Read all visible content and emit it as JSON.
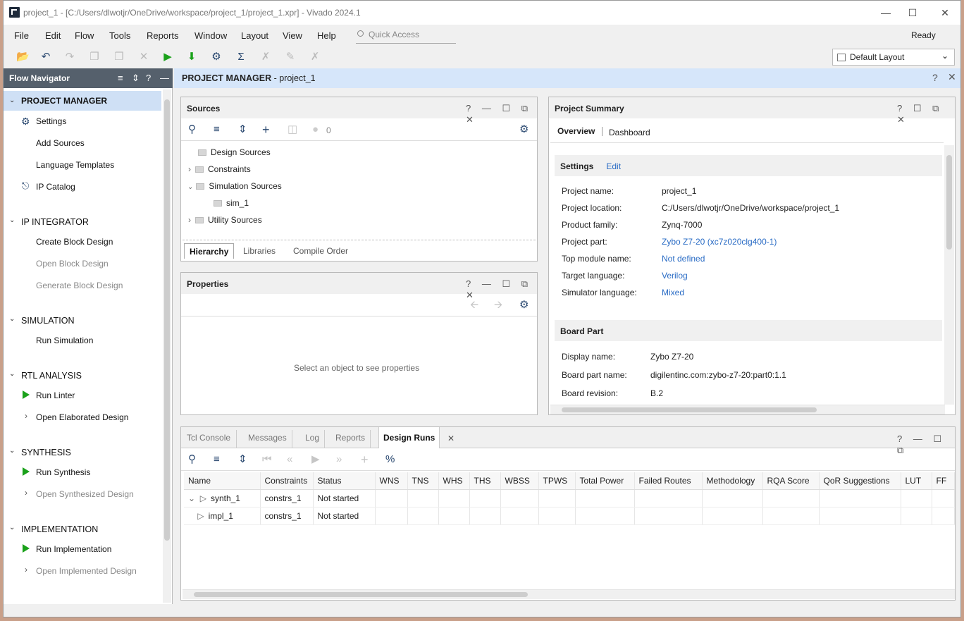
{
  "window": {
    "title": "project_1 - [C:/Users/dlwotjr/OneDrive/workspace/project_1/project_1.xpr] - Vivado 2024.1"
  },
  "menu": [
    "File",
    "Edit",
    "Flow",
    "Tools",
    "Reports",
    "Window",
    "Layout",
    "View",
    "Help"
  ],
  "quick_access": "Quick Access",
  "status": "Ready",
  "layout_select": "Default Layout",
  "flow_nav": {
    "title": "Flow Navigator",
    "project_manager": "PROJECT MANAGER",
    "settings": "Settings",
    "add_sources": "Add Sources",
    "lang_templates": "Language Templates",
    "ip_catalog": "IP Catalog",
    "ip_integrator": "IP INTEGRATOR",
    "create_bd": "Create Block Design",
    "open_bd": "Open Block Design",
    "gen_bd": "Generate Block Design",
    "simulation": "SIMULATION",
    "run_sim": "Run Simulation",
    "rtl": "RTL ANALYSIS",
    "run_linter": "Run Linter",
    "open_elab": "Open Elaborated Design",
    "synthesis": "SYNTHESIS",
    "run_synth": "Run Synthesis",
    "open_synth": "Open Synthesized Design",
    "implementation": "IMPLEMENTATION",
    "run_impl": "Run Implementation",
    "open_impl": "Open Implemented Design"
  },
  "main_header": {
    "title": "PROJECT MANAGER",
    "project": " - project_1"
  },
  "sources": {
    "title": "Sources",
    "count": "0",
    "tree": {
      "design": "Design Sources",
      "constraints": "Constraints",
      "simulation": "Simulation Sources",
      "sim1": "sim_1",
      "utility": "Utility Sources"
    },
    "tabs": [
      "Hierarchy",
      "Libraries",
      "Compile Order"
    ]
  },
  "properties": {
    "title": "Properties",
    "empty": "Select an object to see properties"
  },
  "summary": {
    "title": "Project Summary",
    "tab_overview": "Overview",
    "tab_dashboard": "Dashboard",
    "settings_label": "Settings",
    "edit": "Edit",
    "rows": [
      {
        "k": "Project name:",
        "v": "project_1"
      },
      {
        "k": "Project location:",
        "v": "C:/Users/dlwotjr/OneDrive/workspace/project_1"
      },
      {
        "k": "Product family:",
        "v": "Zynq-7000"
      },
      {
        "k": "Project part:",
        "v": "Zybo Z7-20 (xc7z020clg400-1)"
      },
      {
        "k": "Top module name:",
        "v": "Not defined"
      },
      {
        "k": "Target language:",
        "v": "Verilog"
      },
      {
        "k": "Simulator language:",
        "v": "Mixed"
      }
    ],
    "board_label": "Board Part",
    "board_rows": [
      {
        "k": "Display name:",
        "v": "Zybo Z7-20"
      },
      {
        "k": "Board part name:",
        "v": "digilentinc.com:zybo-z7-20:part0:1.1"
      },
      {
        "k": "Board revision:",
        "v": "B.2"
      }
    ]
  },
  "bottom": {
    "tabs": [
      "Tcl Console",
      "Messages",
      "Log",
      "Reports",
      "Design Runs"
    ],
    "columns": [
      "Name",
      "Constraints",
      "Status",
      "WNS",
      "TNS",
      "WHS",
      "THS",
      "WBSS",
      "TPWS",
      "Total Power",
      "Failed Routes",
      "Methodology",
      "RQA Score",
      "QoR Suggestions",
      "LUT",
      "FF"
    ],
    "runs": [
      {
        "name": "synth_1",
        "constraints": "constrs_1",
        "status": "Not started"
      },
      {
        "name": "impl_1",
        "constraints": "constrs_1",
        "status": "Not started"
      }
    ]
  },
  "colors": {
    "accent": "#2a6cc5",
    "header_bg": "#d6e6fa",
    "nav_header": "#55606c",
    "run_green": "#1aa11a"
  }
}
